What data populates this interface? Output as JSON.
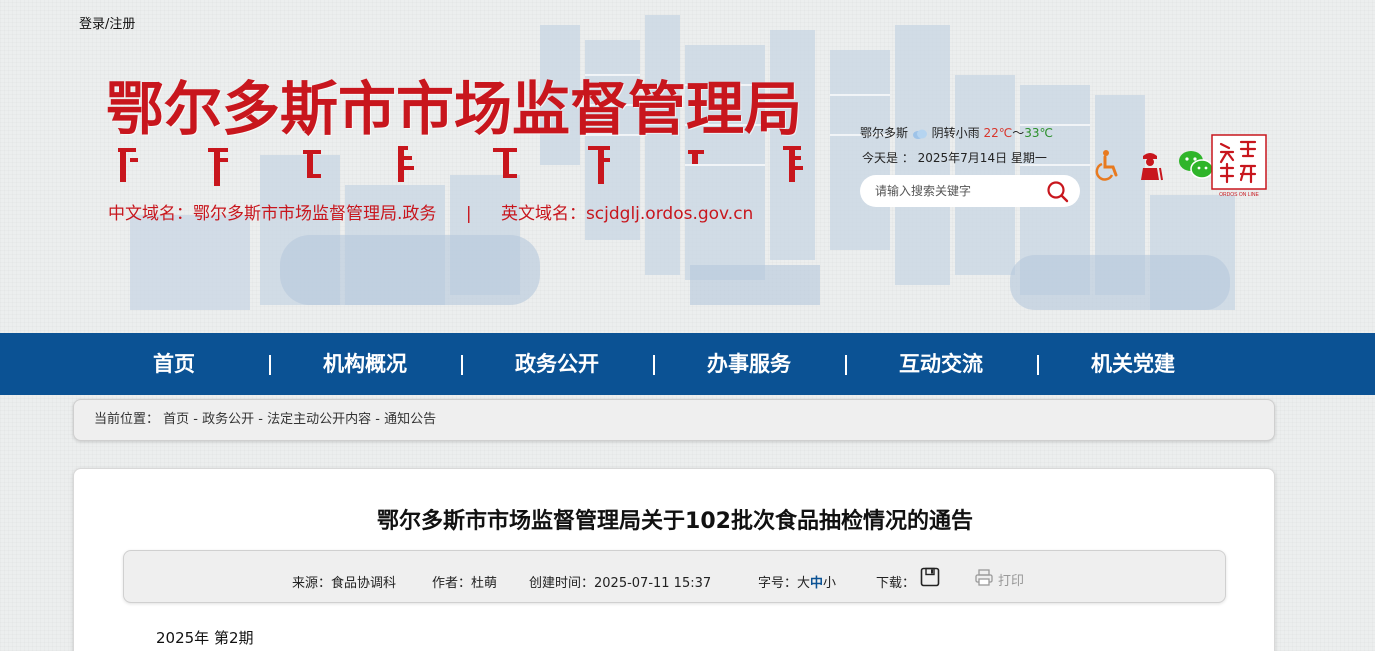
{
  "header": {
    "login_label": "登录/注册",
    "site_title": "鄂尔多斯市市场监督管理局",
    "chinese_domain_label": "中文域名：鄂尔多斯市市场监督管理局.政务",
    "separator": "|",
    "english_domain_label": "英文域名：scjdglj.ordos.gov.cn",
    "weather": {
      "city": "鄂尔多斯",
      "condition": "阴转小雨",
      "temp_low": "22℃",
      "range_sep": "～",
      "temp_high": "33℃"
    },
    "today": "今天是 ： 2025年7月14日 星期一",
    "search": {
      "placeholder": "请输入搜索关键字"
    },
    "logo_text": "ORDOS ON LINE",
    "icons": [
      "wheelchair-icon",
      "elder-care-icon",
      "wechat-icon"
    ]
  },
  "nav": {
    "items": [
      "首页",
      "机构概况",
      "政务公开",
      "办事服务",
      "互动交流",
      "机关党建"
    ],
    "separator": "|"
  },
  "breadcrumb": {
    "prefix": "当前位置：",
    "items": [
      "首页",
      "政务公开",
      "法定主动公开内容",
      "通知公告"
    ],
    "separator": " - "
  },
  "article": {
    "title": "鄂尔多斯市市场监督管理局关于102批次食品抽检情况的通告",
    "meta": {
      "source": "来源：食品协调科",
      "author": "作者：杜萌",
      "created": "创建时间：2025-07-11 15:37",
      "font_label": "字号：",
      "font_big": "大",
      "font_mid": "中",
      "font_small": "小",
      "download_label": "下载：",
      "print_label": "打印"
    },
    "issue": "2025年  第2期"
  },
  "colors": {
    "brand_red": "#c8161d",
    "nav_blue": "#0b5294",
    "page_bg": "#eceeee"
  }
}
